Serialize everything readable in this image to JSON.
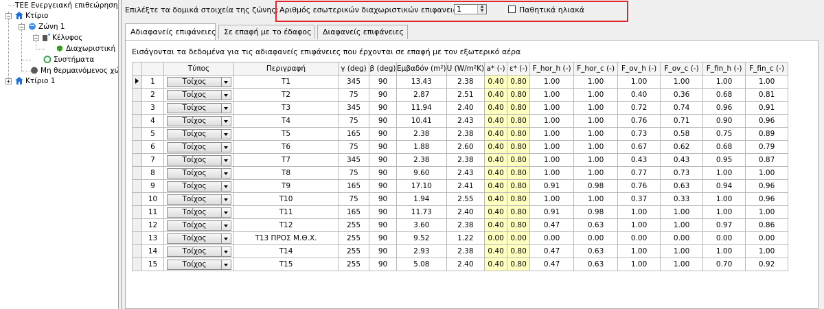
{
  "tree": {
    "root": "Ενεργειακή επιθεώρηση",
    "root_prefix": "ΤΕΕ",
    "building1": "Κτίριο",
    "zone": "Ζώνη 1",
    "envelope": "Κέλυφος",
    "partition": "Διαχωριστική",
    "systems": "Συστήματα",
    "unheated": "Μη θερμαινόμενος χώ",
    "building2": "Κτίριο 1"
  },
  "toolbar": {
    "select_label": "Επιλέξτε τα δομικά στοιχεία της ζώνης:",
    "partitions_label": "Αριθμός εσωτερικών διαχωριστικών επιφανειών:",
    "partitions_value": "1",
    "passive_solar_label": "Παθητικά ηλιακά",
    "passive_solar_checked": false
  },
  "tabs": [
    {
      "label": "Αδιαφανείς επιφάνειες",
      "active": true
    },
    {
      "label": "Σε επαφή με το έδαφος",
      "active": false
    },
    {
      "label": "Διαφανείς επιφάνειες",
      "active": false
    }
  ],
  "description": "Εισάγονται τα δεδομένα για τις αδιαφανείς επιφάνειες που έρχονται σε επαφή με τον εξωτερικό αέρα",
  "grid": {
    "columns": [
      "",
      "",
      "Τύπος",
      "Περιγραφή",
      "γ (deg)",
      "β (deg)",
      "Εμβαδόν (m²)",
      "U (W/m²K)",
      "a* (-)",
      "ε* (-)",
      "F_hor_h (-)",
      "F_hor_c (-)",
      "F_ov_h (-)",
      "F_ov_c (-)",
      "F_fin_h (-)",
      "F_fin_c (-)"
    ],
    "rows": [
      [
        "1",
        "Τοίχος",
        "T1",
        "345",
        "90",
        "13.43",
        "2.38",
        "0.40",
        "0.80",
        "1.00",
        "1.00",
        "1.00",
        "1.00",
        "1.00",
        "1.00"
      ],
      [
        "2",
        "Τοίχος",
        "T2",
        "75",
        "90",
        "2.87",
        "2.51",
        "0.40",
        "0.80",
        "1.00",
        "1.00",
        "0.40",
        "0.36",
        "0.68",
        "0.81"
      ],
      [
        "3",
        "Τοίχος",
        "T3",
        "345",
        "90",
        "11.94",
        "2.40",
        "0.40",
        "0.80",
        "1.00",
        "1.00",
        "0.72",
        "0.74",
        "0.96",
        "0.91"
      ],
      [
        "4",
        "Τοίχος",
        "T4",
        "75",
        "90",
        "10.41",
        "2.43",
        "0.40",
        "0.80",
        "1.00",
        "1.00",
        "0.76",
        "0.71",
        "0.90",
        "0.96"
      ],
      [
        "5",
        "Τοίχος",
        "T5",
        "165",
        "90",
        "2.38",
        "2.38",
        "0.40",
        "0.80",
        "1.00",
        "1.00",
        "0.73",
        "0.58",
        "0.75",
        "0.89"
      ],
      [
        "6",
        "Τοίχος",
        "T6",
        "75",
        "90",
        "1.88",
        "2.60",
        "0.40",
        "0.80",
        "1.00",
        "1.00",
        "0.67",
        "0.62",
        "0.68",
        "0.79"
      ],
      [
        "7",
        "Τοίχος",
        "T7",
        "345",
        "90",
        "2.38",
        "2.38",
        "0.40",
        "0.80",
        "1.00",
        "1.00",
        "0.43",
        "0.43",
        "0.95",
        "0.87"
      ],
      [
        "8",
        "Τοίχος",
        "T8",
        "75",
        "90",
        "9.60",
        "2.43",
        "0.40",
        "0.80",
        "1.00",
        "1.00",
        "0.77",
        "0.73",
        "1.00",
        "1.00"
      ],
      [
        "9",
        "Τοίχος",
        "T9",
        "165",
        "90",
        "17.10",
        "2.41",
        "0.40",
        "0.80",
        "0.91",
        "0.98",
        "0.76",
        "0.63",
        "0.94",
        "0.96"
      ],
      [
        "10",
        "Τοίχος",
        "T10",
        "75",
        "90",
        "1.94",
        "2.55",
        "0.40",
        "0.80",
        "1.00",
        "1.00",
        "0.37",
        "0.33",
        "1.00",
        "0.96"
      ],
      [
        "11",
        "Τοίχος",
        "T11",
        "165",
        "90",
        "11.73",
        "2.40",
        "0.40",
        "0.80",
        "0.91",
        "0.98",
        "1.00",
        "1.00",
        "1.00",
        "1.00"
      ],
      [
        "12",
        "Τοίχος",
        "T12",
        "255",
        "90",
        "3.60",
        "2.38",
        "0.40",
        "0.80",
        "0.47",
        "0.63",
        "1.00",
        "1.00",
        "0.97",
        "0.86"
      ],
      [
        "13",
        "Τοίχος",
        "T13 ΠΡΟΣ Μ.Θ.Χ.",
        "255",
        "90",
        "9.52",
        "1.22",
        "0.00",
        "0.00",
        "0.00",
        "0.00",
        "0.00",
        "0.00",
        "0.00",
        "0.00"
      ],
      [
        "14",
        "Τοίχος",
        "T14",
        "255",
        "90",
        "2.93",
        "2.38",
        "0.40",
        "0.80",
        "0.47",
        "0.63",
        "1.00",
        "1.00",
        "1.00",
        "1.00"
      ],
      [
        "15",
        "Τοίχος",
        "T15",
        "255",
        "90",
        "5.08",
        "2.40",
        "0.40",
        "0.80",
        "0.47",
        "0.63",
        "1.00",
        "1.00",
        "0.70",
        "0.92"
      ]
    ],
    "current_row": 0
  },
  "colors": {
    "highlight_box": "#e0262b",
    "yellow_cells": "#ffffc0",
    "panel_bg": "#f0f0f0"
  }
}
